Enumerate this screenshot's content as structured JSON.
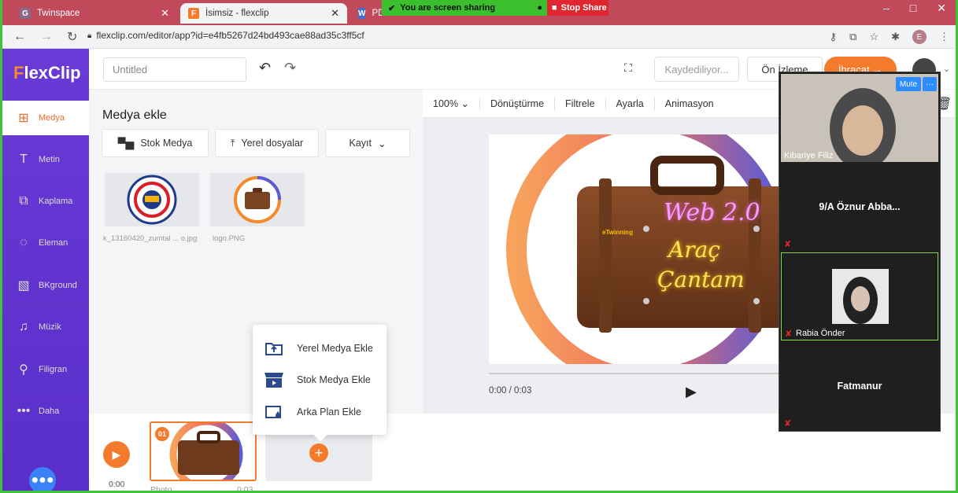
{
  "browser": {
    "tabs": [
      {
        "label": "Twinspace",
        "favicon_color": "#8a6a8a",
        "favicon_text": "G"
      },
      {
        "label": "İsimsiz - flexclip",
        "favicon_color": "#f57b2c",
        "favicon_text": "F"
      },
      {
        "label": "PD",
        "favicon_color": "#3b6fd8",
        "favicon_text": "W"
      }
    ],
    "sharing_text": "You are screen sharing",
    "stop_share_label": "Stop Share",
    "url": "flexclip.com/editor/app?id=e4fb5267d24bd493cae88ad35c3ff5cf",
    "profile_initial": "E"
  },
  "app": {
    "logo_prefix": "F",
    "logo_rest": "lexClip",
    "title_placeholder": "Untitled",
    "saving_label": "Kaydediliyor...",
    "preview_label": "Ön İzleme",
    "export_label": "İhracat →"
  },
  "sidebar": {
    "items": [
      {
        "label": "Medya",
        "icon": "media-icon"
      },
      {
        "label": "Metin",
        "icon": "text-icon"
      },
      {
        "label": "Kaplama",
        "icon": "overlay-icon"
      },
      {
        "label": "Eleman",
        "icon": "element-icon"
      },
      {
        "label": "BKground",
        "icon": "background-icon"
      },
      {
        "label": "Müzik",
        "icon": "music-icon"
      },
      {
        "label": "Filigran",
        "icon": "watermark-icon"
      },
      {
        "label": "Daha",
        "icon": "more-icon"
      }
    ]
  },
  "media_panel": {
    "title": "Medya ekle",
    "stock_label": "Stok Medya",
    "local_label": "Yerel dosyalar",
    "record_label": "Kayıt",
    "caption_1": "k_13160420_zumtal ... o.jpg",
    "caption_2": "logo.PNG"
  },
  "canvas_tools": {
    "zoom": "100%",
    "transform": "Dönüştürme",
    "filter": "Filtrele",
    "adjust": "Ayarla",
    "animation": "Animasyon"
  },
  "canvas_text": {
    "line1": "Web 2.0",
    "line2": "Araç",
    "line3": "Çantam",
    "twinning": "eTwinning"
  },
  "player": {
    "time": "0:00 / 0:03"
  },
  "timeline": {
    "time": "0:00",
    "clip_number": "01",
    "clip_label": "Photo",
    "clip_duration": "0:03"
  },
  "popup": {
    "items": [
      "Yerel Medya Ekle",
      "Stok Medya Ekle",
      "Arka Plan Ekle"
    ]
  },
  "video_call": {
    "mute_label": "Mute",
    "more_label": "···",
    "participants": [
      {
        "name": "Kibariye Filiz"
      },
      {
        "name": "9/A Öznur Abba..."
      },
      {
        "name": "Rabia Önder"
      },
      {
        "name": "Fatmanur"
      }
    ]
  }
}
